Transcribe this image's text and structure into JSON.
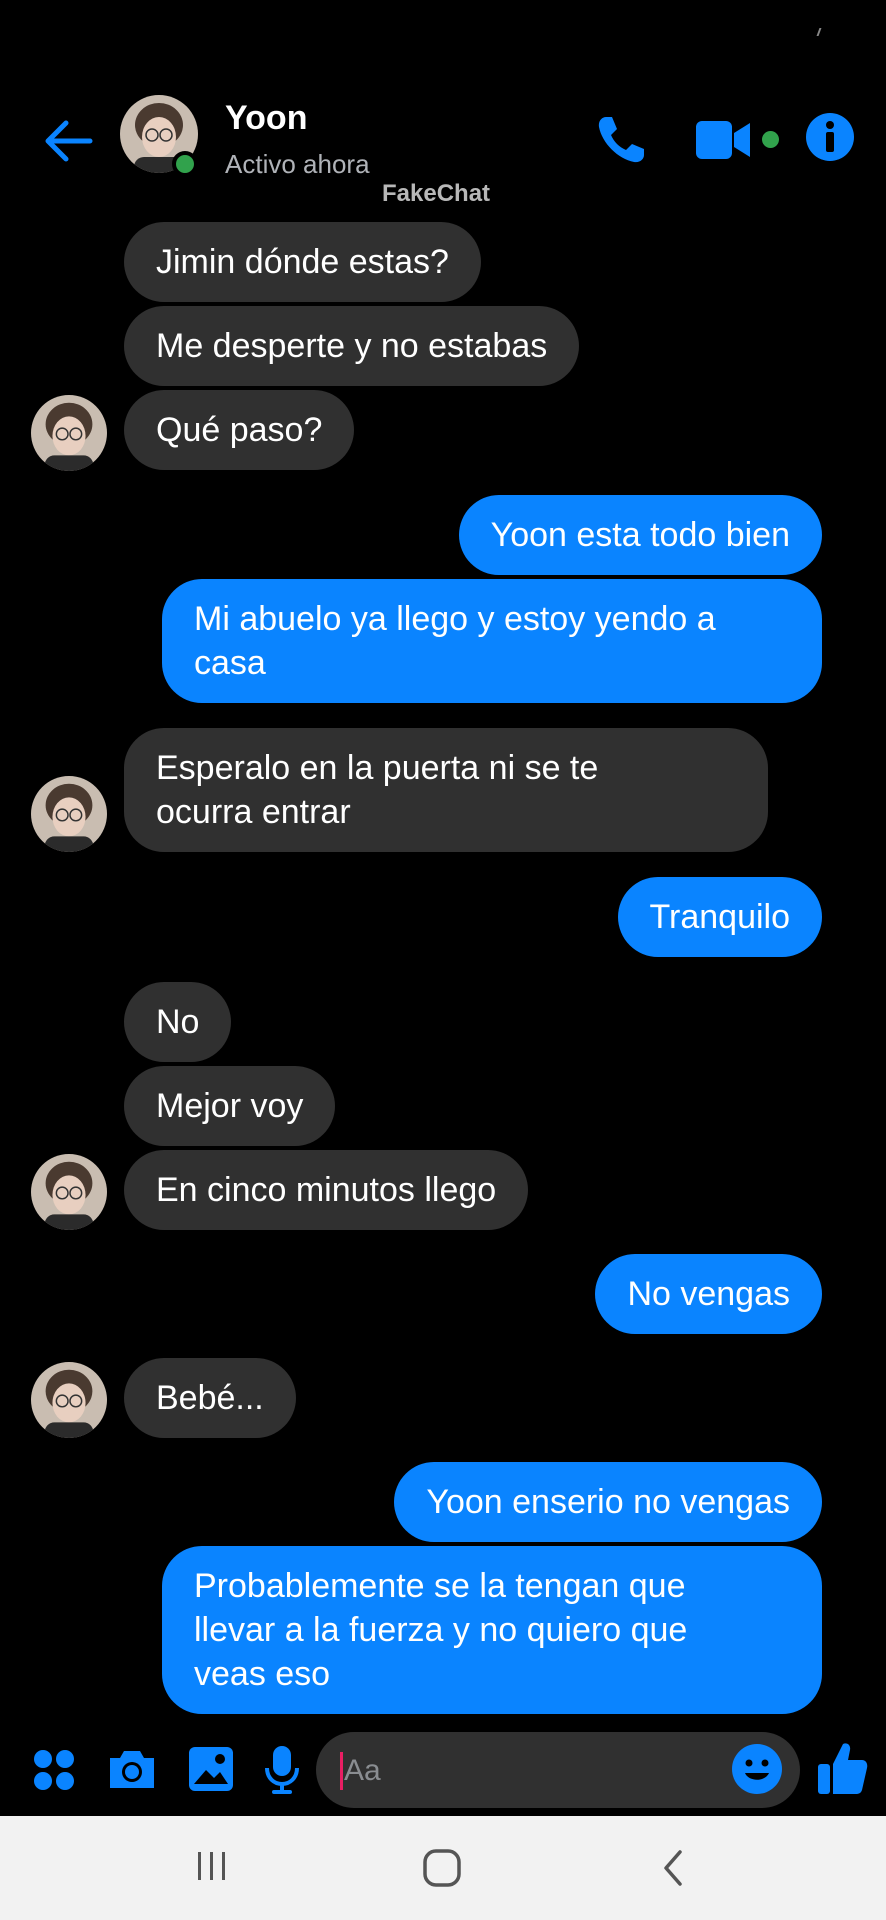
{
  "contact": {
    "name": "Yoon",
    "status": "Activo ahora"
  },
  "watermark": "FakeChat",
  "messages": [
    {
      "side": "in",
      "text": "Jimin dónde estas?"
    },
    {
      "side": "in",
      "text": "Me desperte y no estabas"
    },
    {
      "side": "in",
      "text": "Qué paso?"
    },
    {
      "side": "out",
      "text": "Yoon esta todo bien"
    },
    {
      "side": "out",
      "text": "Mi abuelo ya llego y estoy yendo a casa",
      "line1": "Mi abuelo ya llego y estoy yendo a",
      "line2": "casa"
    },
    {
      "side": "in",
      "text": "Esperalo en la puerta ni se te ocurra entrar",
      "line1": "Esperalo en la puerta ni se te",
      "line2": "ocurra entrar"
    },
    {
      "side": "out",
      "text": "Tranquilo"
    },
    {
      "side": "in",
      "text": "No"
    },
    {
      "side": "in",
      "text": "Mejor voy"
    },
    {
      "side": "in",
      "text": "En cinco minutos llego"
    },
    {
      "side": "out",
      "text": "No vengas"
    },
    {
      "side": "in",
      "text": "Bebé..."
    },
    {
      "side": "out",
      "text": "Yoon enserio no vengas"
    },
    {
      "side": "out",
      "text": "Probablemente se la tengan que llevar a la fuerza y no quiero que veas eso",
      "line1": "Probablemente se la tengan que",
      "line2": "llevar a la fuerza y no quiero que",
      "line3": "veas eso"
    }
  ],
  "composer": {
    "placeholder": "Aa"
  },
  "icons": {
    "back": "arrow-left-icon",
    "call": "phone-icon",
    "video": "video-camera-icon",
    "info": "info-icon",
    "apps": "apps-grid-icon",
    "camera": "camera-icon",
    "gallery": "image-icon",
    "mic": "microphone-icon",
    "emoji": "emoji-icon",
    "like": "thumbs-up-icon"
  },
  "colors": {
    "accent": "#0a84ff",
    "incoming_bubble": "#303030",
    "online": "#31a24c",
    "background": "#000000"
  }
}
